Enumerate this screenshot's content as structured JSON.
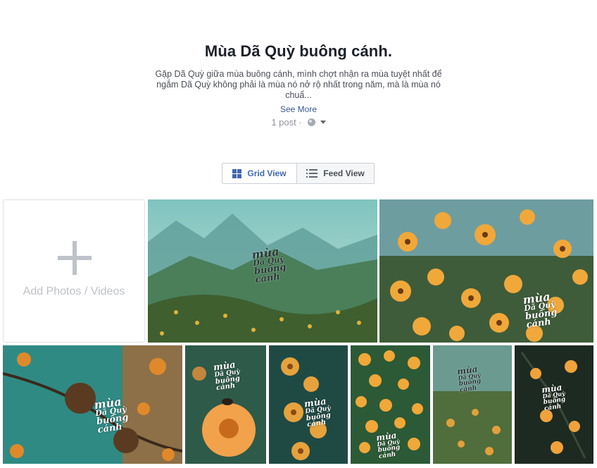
{
  "album": {
    "title": "Mùa Dã Quỳ buông cánh.",
    "description": "Gặp Dã Quỳ giữa mùa buông cánh, mình chợt nhận ra mùa tuyệt nhất để ngắm Dã Quỳ không phải là mùa nó nở rộ nhất trong năm, mà là mùa nó chuẩ...",
    "see_more": "See More",
    "post_count": "1 post ·",
    "privacy_icon": "globe-icon"
  },
  "view_toggle": {
    "grid_label": "Grid View",
    "feed_label": "Feed View"
  },
  "add_tile": {
    "label": "Add Photos / Videos"
  },
  "watermark": {
    "line1": "mùa",
    "line2": "Dã Quỳ",
    "line3": "buông",
    "line4": "cánh"
  },
  "colors": {
    "link": "#365899",
    "accent": "#4267b2"
  }
}
